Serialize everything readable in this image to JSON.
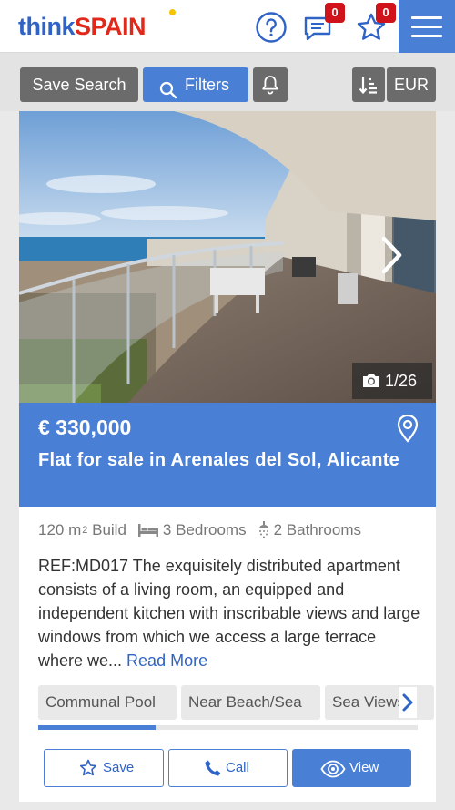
{
  "header": {
    "logo_think": "think",
    "logo_spain": "SPAIN",
    "messages_badge": "0",
    "favourites_badge": "0",
    "icons": [
      "help-icon",
      "messages-icon",
      "favourites-star-icon",
      "menu-icon"
    ]
  },
  "toolbar": {
    "save_search_label": "Save Search",
    "filters_label": "Filters",
    "currency_label": "EUR"
  },
  "listing": {
    "photo_counter": "1/26",
    "price": "€ 330,000",
    "title": "Flat for sale in Arenales del Sol, Alicante",
    "area_value": "120 m",
    "area_unit_sup": "2",
    "area_label": "Build",
    "bedrooms": "3 Bedrooms",
    "bathrooms": "2 Bathrooms",
    "description": "REF:MD017 The exquisitely distributed apartment consists of a living room, an equipped and independent kitchen with inscribable views and large windows from which we access a large terrace where we... ",
    "read_more": "Read More",
    "tags": [
      "Communal Pool",
      "Near Beach/Sea",
      "Sea Views"
    ],
    "tags_scroll_progress": 0.31
  },
  "actions": {
    "save_label": "Save",
    "call_label": "Call",
    "view_label": "View"
  },
  "colors": {
    "brand_blue": "#4a7fd6",
    "logo_blue": "#2f63c5",
    "logo_red": "#e0291a",
    "badge_red": "#d0121b",
    "toolbar_gray": "#6b6b6b"
  }
}
